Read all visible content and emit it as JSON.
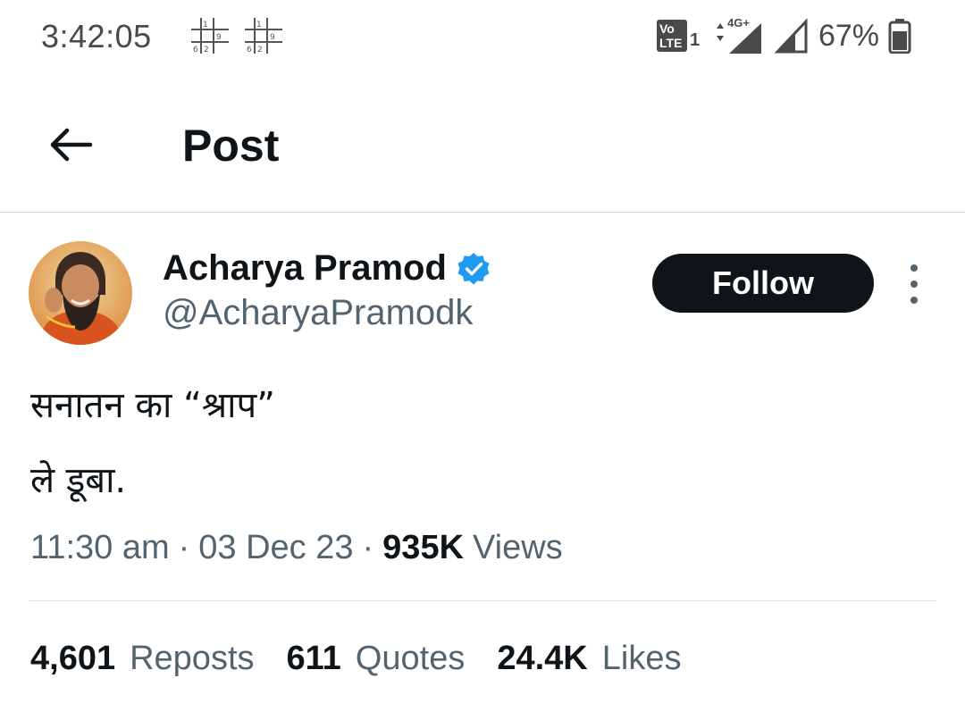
{
  "status_bar": {
    "time": "3:42:05",
    "network": "4G+",
    "volte_label": "Vo LTE 1",
    "battery_percent": "67%"
  },
  "header": {
    "title": "Post"
  },
  "author": {
    "name": "Acharya Pramod",
    "handle": "@AcharyaPramodk",
    "verified": true
  },
  "follow_button": {
    "label": "Follow"
  },
  "tweet": {
    "text": "सनातन का “श्राप”\nले डूबा."
  },
  "meta": {
    "time": "11:30 am",
    "separator": "·",
    "date": "03 Dec 23",
    "views_count": "935K",
    "views_label": "Views"
  },
  "stats": {
    "reposts_count": "4,601",
    "reposts_label": "Reposts",
    "quotes_count": "611",
    "quotes_label": "Quotes",
    "likes_count": "24.4K",
    "likes_label": "Likes"
  },
  "colors": {
    "primary_text": "#0f1419",
    "secondary_text": "#536471",
    "verified_blue": "#1d9bf0",
    "follow_bg": "#0f1419",
    "divider": "#d5d9dc"
  }
}
